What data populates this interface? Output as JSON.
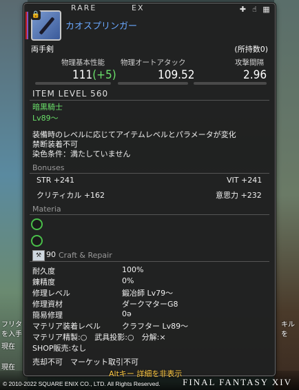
{
  "tooltip": {
    "rarity_text": "RARE",
    "ex_text": "EX",
    "top_icons": [
      "plus-icon",
      "hand-icon",
      "inventory-icon"
    ],
    "item_name": "カオスプリンガー",
    "category": "両手剣",
    "owned": "(所持数0)",
    "stats": {
      "physical_damage_label": "物理基本性能",
      "physical_damage_value": "111",
      "physical_damage_bonus": "(+5)",
      "auto_attack_label": "物理オートアタック",
      "auto_attack_value": "109.52",
      "delay_label": "攻撃間隔",
      "delay_value": "2.96"
    },
    "item_level": "ITEM LEVEL 560",
    "job": "暗黒騎士",
    "level": "Lv89～",
    "description": [
      "装備時のレベルに応じてアイテムレベルとパラメータが変化",
      "禁断装着不可",
      "染色条件：満たしていません"
    ],
    "bonuses_title": "Bonuses",
    "bonuses": [
      {
        "name": "STR +241"
      },
      {
        "name": "VIT +241"
      },
      {
        "name": "クリティカル +162"
      },
      {
        "name": "意思力 +232"
      }
    ],
    "materia_title": "Materia",
    "craft_level": "90",
    "craft_title": "Craft & Repair",
    "craft_rows": [
      {
        "k": "耐久度",
        "v": "100%"
      },
      {
        "k": "錬精度",
        "v": "0%"
      },
      {
        "k": "修理レベル",
        "v": "鍛冶師 Lv79～"
      },
      {
        "k": "修理資材",
        "v": "ダークマターG8"
      },
      {
        "k": "簡易修理",
        "v": "0ə"
      },
      {
        "k": "マテリア装着レベル",
        "v": "クラフター Lv89～"
      }
    ],
    "materia_line": "マテリア精製:○　武具投影:○　分解:×",
    "shop_line": "SHOP販売:なし",
    "sell_line": "売却不可　マーケット取引不可"
  },
  "overlay": {
    "alt_hint": "Altキー 詳細を非表示",
    "copyright": "© 2010-2022 SQUARE ENIX CO., LTD. All Rights Reserved.",
    "logo": "FINAL FANTASY XIV",
    "left_fragments": [
      "フリタ",
      "を入手",
      "現在",
      "現在"
    ],
    "right_fragments": [
      "キル",
      "を"
    ]
  }
}
